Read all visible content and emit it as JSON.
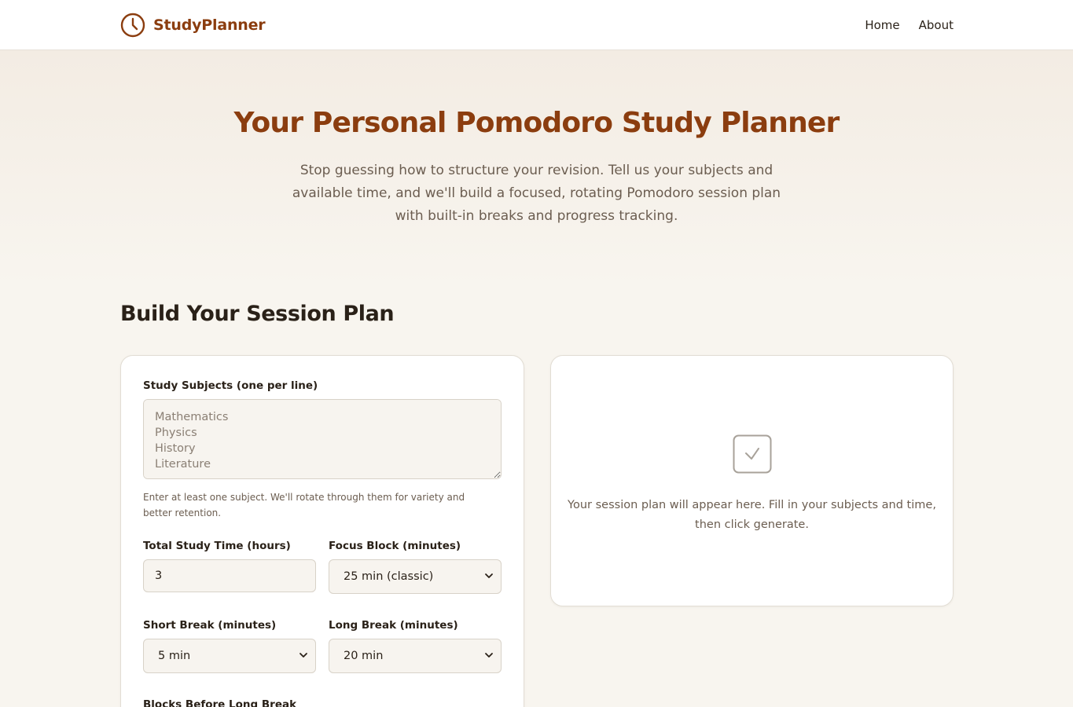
{
  "nav": {
    "brand": "StudyPlanner",
    "brand_icon": "clock-icon",
    "links": [
      "Home",
      "About"
    ]
  },
  "hero": {
    "title": "Your Personal Pomodoro Study Planner",
    "subtitle": "Stop guessing how to structure your revision. Tell us your subjects and available time, and we'll build a focused, rotating Pomodoro session plan with built-in breaks and progress tracking."
  },
  "builder": {
    "title": "Build Your Session Plan",
    "subjects": {
      "label": "Study Subjects (one per line)",
      "placeholder": "Mathematics\nPhysics\nHistory\nLiterature",
      "help": "Enter at least one subject. We'll rotate through them for variety and better retention."
    },
    "total_time": {
      "label": "Total Study Time (hours)",
      "value": "3"
    },
    "focus_block": {
      "label": "Focus Block (minutes)",
      "value": "25 min (classic)"
    },
    "short_break": {
      "label": "Short Break (minutes)",
      "value": "5 min"
    },
    "long_break": {
      "label": "Long Break (minutes)",
      "value": "20 min"
    },
    "blocks_before_long": {
      "label": "Blocks Before Long Break"
    }
  },
  "plan": {
    "icon": "checkbox-icon",
    "placeholder": "Your session plan will appear here. Fill in your subjects and time, then click generate."
  },
  "colors": {
    "brand": "#8b3d0f",
    "background": "#f8f5ef",
    "text": "#2a2118",
    "muted": "#6b5d50"
  }
}
